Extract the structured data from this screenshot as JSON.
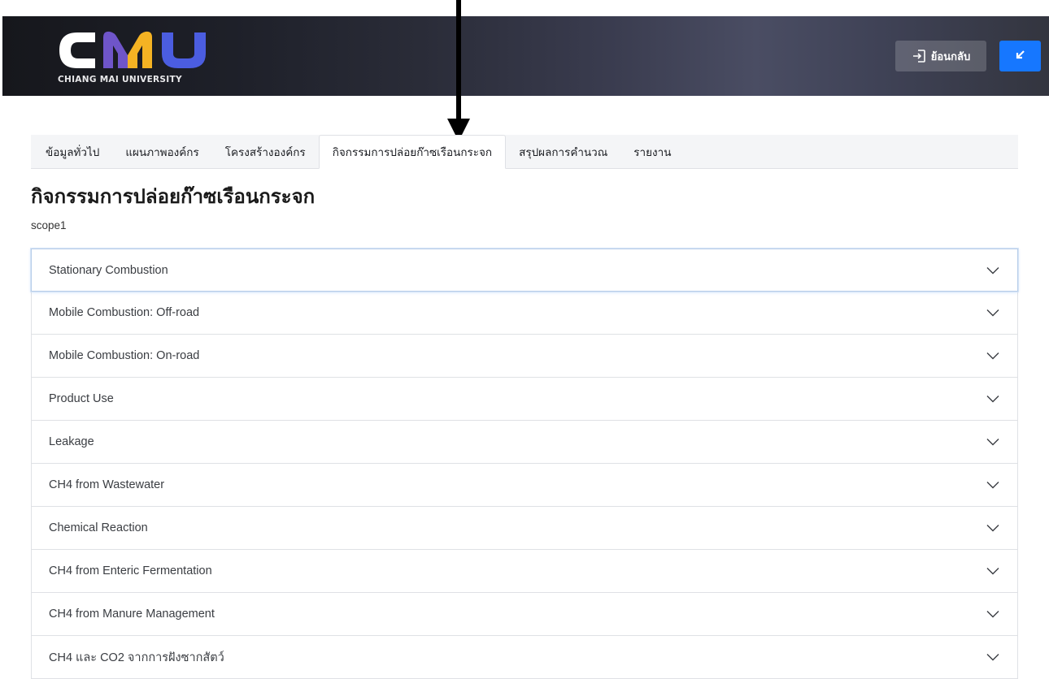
{
  "header": {
    "logo_text": "CMU",
    "logo_subtitle": "CHIANG MAI UNIVERSITY",
    "back_label": "ย้อนกลับ",
    "logo_colors": {
      "c": "#ffffff",
      "m_left": "#6f55c9",
      "m_right": "#f5b323",
      "u": "#4b5de0"
    }
  },
  "tabs": [
    {
      "label": "ข้อมูลทั่วไป",
      "active": false
    },
    {
      "label": "แผนภาพองค์กร",
      "active": false
    },
    {
      "label": "โครงสร้างองค์กร",
      "active": false
    },
    {
      "label": "กิจกรรมการปล่อยก๊าซเรือนกระจก",
      "active": true
    },
    {
      "label": "สรุปผลการคำนวณ",
      "active": false
    },
    {
      "label": "รายงาน",
      "active": false
    }
  ],
  "page": {
    "title": "กิจกรรมการปล่อยก๊าซเรือนกระจก",
    "scope": "scope1"
  },
  "accordion": [
    {
      "label": "Stationary Combustion"
    },
    {
      "label": "Mobile Combustion: Off-road"
    },
    {
      "label": "Mobile Combustion: On-road"
    },
    {
      "label": "Product Use"
    },
    {
      "label": "Leakage"
    },
    {
      "label": "CH4 from Wastewater"
    },
    {
      "label": "Chemical Reaction"
    },
    {
      "label": "CH4 from Enteric Fermentation"
    },
    {
      "label": "CH4 from Manure Management"
    },
    {
      "label": "CH4 และ CO2 จากการฝังซากสัตว์"
    }
  ],
  "icons": {
    "back": "exit-arrow-icon",
    "collapse": "collapse-arrow-icon",
    "chevron": "chevron-down-icon"
  },
  "colors": {
    "accent": "#1677ff"
  }
}
